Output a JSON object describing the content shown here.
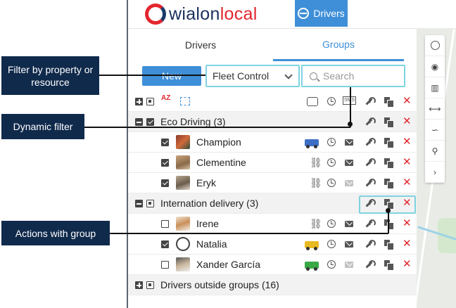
{
  "header": {
    "logo_text_a": "wialon",
    "logo_text_b": "local",
    "badge_label": "Drivers"
  },
  "tabs": [
    {
      "label": "Drivers",
      "active": false
    },
    {
      "label": "Groups",
      "active": true
    }
  ],
  "toolbar": {
    "new_label": "New",
    "filter_value": "Fleet Control",
    "search_placeholder": "Search"
  },
  "columns": {
    "sort_label": "AZ",
    "sms_label": "SMS"
  },
  "groups": [
    {
      "name": "Eco Driving (3)",
      "expanded": true,
      "checked": true,
      "drivers": [
        {
          "name": "Champion",
          "checked": true,
          "vehicle": "truck-blue-icon",
          "mail_active": true
        },
        {
          "name": "Clementine",
          "checked": true,
          "vehicle": "unbind-icon",
          "mail_active": true
        },
        {
          "name": "Eryk",
          "checked": true,
          "vehicle": "unbind-icon",
          "mail_active": false
        }
      ]
    },
    {
      "name": "Internation delivery (3)",
      "expanded": true,
      "checked": false,
      "drivers": [
        {
          "name": "Irene",
          "checked": false,
          "vehicle": "unbind-icon",
          "mail_active": true
        },
        {
          "name": "Natalia",
          "checked": true,
          "vehicle": "truck-yellow-icon",
          "mail_active": true
        },
        {
          "name": "Xander García",
          "checked": false,
          "vehicle": "bus-green-icon",
          "mail_active": false
        }
      ]
    },
    {
      "name": "Drivers outside groups (16)",
      "expanded": false,
      "checked": false,
      "drivers": []
    }
  ],
  "callouts": {
    "filter": "Filter by property or resource",
    "dynamic": "Dynamic filter",
    "actions": "Actions with group"
  },
  "colors": {
    "accent": "#3f8fd8",
    "highlight": "#7fd3e0",
    "delete": "#e3262e",
    "callout_bg": "#102a4c"
  }
}
